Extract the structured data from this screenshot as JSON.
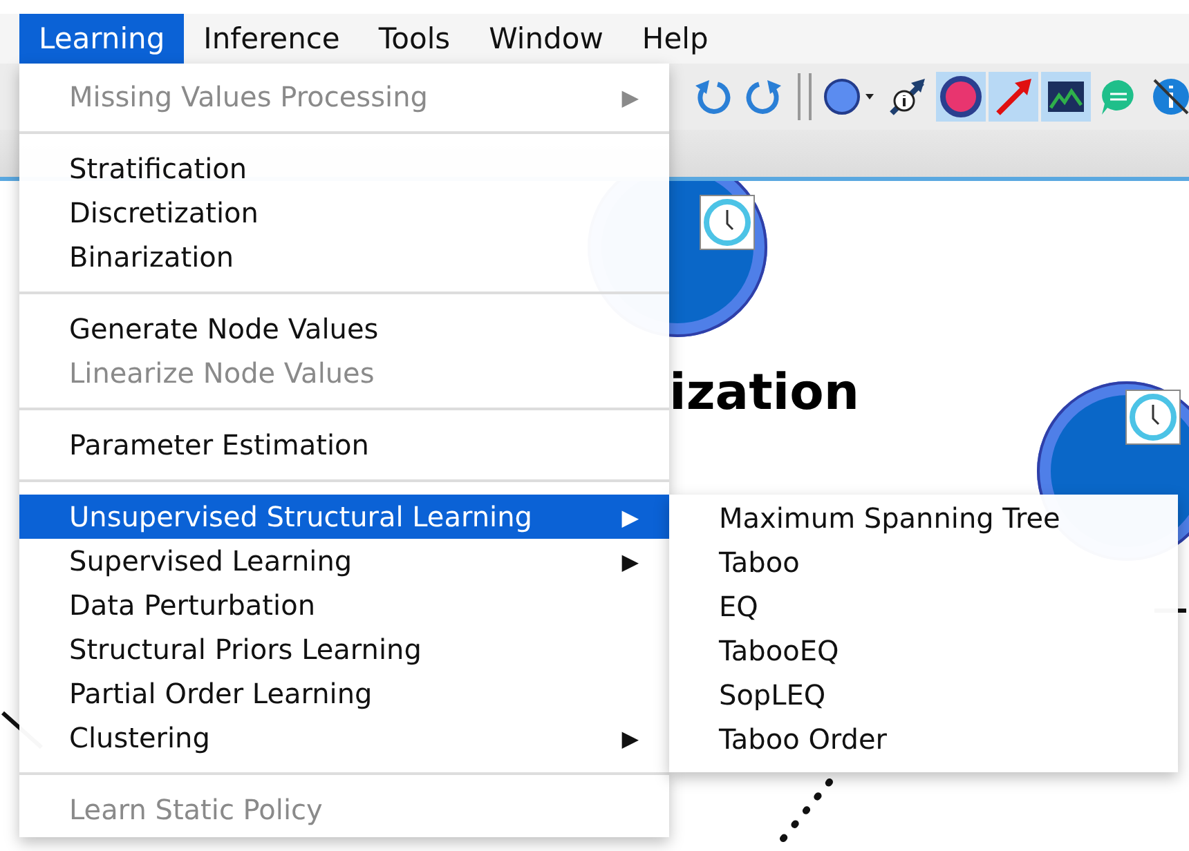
{
  "menubar": [
    {
      "label": "Learning",
      "selected": true
    },
    {
      "label": "Inference",
      "selected": false
    },
    {
      "label": "Tools",
      "selected": false
    },
    {
      "label": "Window",
      "selected": false
    },
    {
      "label": "Help",
      "selected": false
    }
  ],
  "menu": {
    "sections": [
      [
        {
          "label": "Missing Values Processing",
          "disabled": true,
          "submenu": true,
          "selected": false
        }
      ],
      [
        {
          "label": "Stratification",
          "disabled": false,
          "submenu": false,
          "selected": false
        },
        {
          "label": "Discretization",
          "disabled": false,
          "submenu": false,
          "selected": false
        },
        {
          "label": "Binarization",
          "disabled": false,
          "submenu": false,
          "selected": false
        }
      ],
      [
        {
          "label": "Generate Node Values",
          "disabled": false,
          "submenu": false,
          "selected": false
        },
        {
          "label": "Linearize Node Values",
          "disabled": true,
          "submenu": false,
          "selected": false
        }
      ],
      [
        {
          "label": "Parameter Estimation",
          "disabled": false,
          "submenu": false,
          "selected": false
        }
      ],
      [
        {
          "label": "Unsupervised Structural Learning",
          "disabled": false,
          "submenu": true,
          "selected": true
        },
        {
          "label": "Supervised Learning",
          "disabled": false,
          "submenu": true,
          "selected": false
        },
        {
          "label": "Data Perturbation",
          "disabled": false,
          "submenu": false,
          "selected": false
        },
        {
          "label": "Structural Priors Learning",
          "disabled": false,
          "submenu": false,
          "selected": false
        },
        {
          "label": "Partial Order Learning",
          "disabled": false,
          "submenu": false,
          "selected": false
        },
        {
          "label": "Clustering",
          "disabled": false,
          "submenu": true,
          "selected": false
        }
      ],
      [
        {
          "label": "Learn Static Policy",
          "disabled": true,
          "submenu": false,
          "selected": false
        }
      ]
    ],
    "arrow": "▶"
  },
  "submenu": {
    "items": [
      {
        "label": "Maximum Spanning Tree"
      },
      {
        "label": "Taboo"
      },
      {
        "label": "EQ"
      },
      {
        "label": "TabooEQ"
      },
      {
        "label": "SopLEQ"
      },
      {
        "label": "Taboo Order"
      }
    ]
  },
  "canvas": {
    "node_label": "ization"
  }
}
